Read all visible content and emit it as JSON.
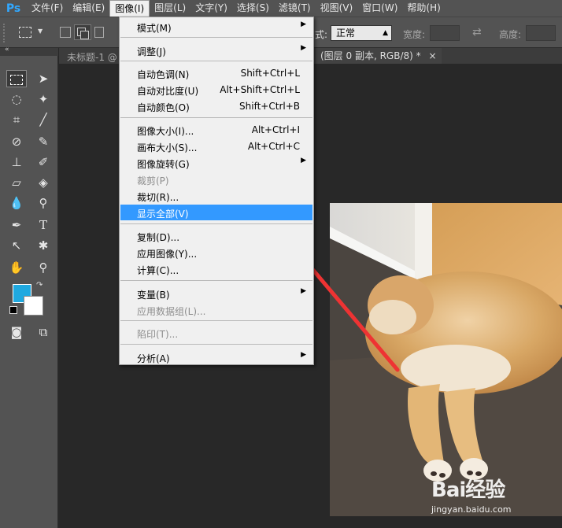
{
  "app": {
    "logo_text": "Ps"
  },
  "menubar": {
    "items": [
      "文件(F)",
      "编辑(E)",
      "图像(I)",
      "图层(L)",
      "文字(Y)",
      "选择(S)",
      "滤镜(T)",
      "视图(V)",
      "窗口(W)",
      "帮助(H)"
    ],
    "active_index": 2
  },
  "options": {
    "style_label": "式:",
    "style_value": "正常",
    "width_label": "宽度:",
    "height_label": "高度:"
  },
  "tabs": {
    "tab1": "未标题-1 @",
    "tab2": "(图层 0 副本, RGB/8) *",
    "close_glyph": "×"
  },
  "image_menu": {
    "items": [
      {
        "label": "模式(M)",
        "shortcut": "",
        "submenu": true,
        "disabled": false,
        "highlighted": false
      },
      {
        "label": "调整(J)",
        "shortcut": "",
        "submenu": true,
        "disabled": false,
        "highlighted": false
      },
      {
        "label": "自动色调(N)",
        "shortcut": "Shift+Ctrl+L",
        "submenu": false,
        "disabled": false,
        "highlighted": false
      },
      {
        "label": "自动对比度(U)",
        "shortcut": "Alt+Shift+Ctrl+L",
        "submenu": false,
        "disabled": false,
        "highlighted": false
      },
      {
        "label": "自动颜色(O)",
        "shortcut": "Shift+Ctrl+B",
        "submenu": false,
        "disabled": false,
        "highlighted": false
      },
      {
        "label": "图像大小(I)...",
        "shortcut": "Alt+Ctrl+I",
        "submenu": false,
        "disabled": false,
        "highlighted": false
      },
      {
        "label": "画布大小(S)...",
        "shortcut": "Alt+Ctrl+C",
        "submenu": false,
        "disabled": false,
        "highlighted": false
      },
      {
        "label": "图像旋转(G)",
        "shortcut": "",
        "submenu": true,
        "disabled": false,
        "highlighted": false
      },
      {
        "label": "裁剪(P)",
        "shortcut": "",
        "submenu": false,
        "disabled": true,
        "highlighted": false
      },
      {
        "label": "裁切(R)...",
        "shortcut": "",
        "submenu": false,
        "disabled": false,
        "highlighted": false
      },
      {
        "label": "显示全部(V)",
        "shortcut": "",
        "submenu": false,
        "disabled": false,
        "highlighted": true
      },
      {
        "label": "复制(D)...",
        "shortcut": "",
        "submenu": false,
        "disabled": false,
        "highlighted": false
      },
      {
        "label": "应用图像(Y)...",
        "shortcut": "",
        "submenu": false,
        "disabled": false,
        "highlighted": false
      },
      {
        "label": "计算(C)...",
        "shortcut": "",
        "submenu": false,
        "disabled": false,
        "highlighted": false
      },
      {
        "label": "变量(B)",
        "shortcut": "",
        "submenu": true,
        "disabled": false,
        "highlighted": false
      },
      {
        "label": "应用数据组(L)...",
        "shortcut": "",
        "submenu": false,
        "disabled": true,
        "highlighted": false
      },
      {
        "label": "陷印(T)...",
        "shortcut": "",
        "submenu": false,
        "disabled": true,
        "highlighted": false
      },
      {
        "label": "分析(A)",
        "shortcut": "",
        "submenu": true,
        "disabled": false,
        "highlighted": false
      }
    ]
  },
  "colors": {
    "foreground": "#1fa9e0",
    "background": "#ffffff",
    "highlight": "#3399ff",
    "arrow": "#ee3333"
  },
  "watermark": {
    "logo": "Bai经验",
    "url": "jingyan.baidu.com"
  }
}
